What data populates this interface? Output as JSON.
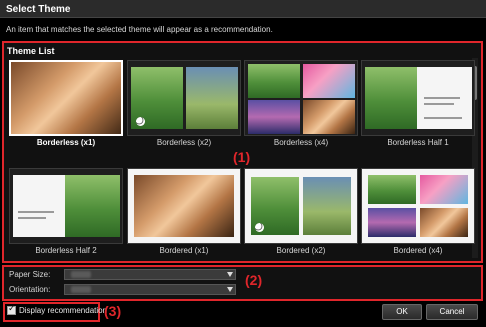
{
  "window": {
    "title": "Select Theme"
  },
  "description": "An item that matches the selected theme will appear as a recommendation.",
  "theme_list": {
    "label": "Theme List",
    "items": [
      {
        "label": "Borderless (x1)",
        "selected": true
      },
      {
        "label": "Borderless (x2)",
        "selected": false
      },
      {
        "label": "Borderless (x4)",
        "selected": false
      },
      {
        "label": "Borderless Half 1",
        "selected": false
      },
      {
        "label": "Borderless Half 2",
        "selected": false
      },
      {
        "label": "Bordered (x1)",
        "selected": false
      },
      {
        "label": "Bordered (x2)",
        "selected": false
      },
      {
        "label": "Bordered (x4)",
        "selected": false
      }
    ]
  },
  "settings": {
    "paper_size_label": "Paper Size:",
    "orientation_label": "Orientation:"
  },
  "callouts": {
    "c1": "(1)",
    "c2": "(2)",
    "c3": "(3)"
  },
  "footer": {
    "display_recommendation_label": "Display recommendation",
    "display_recommendation_checked": true,
    "ok_label": "OK",
    "cancel_label": "Cancel"
  },
  "colors": {
    "highlight": "#e0262b",
    "background": "#000000"
  }
}
